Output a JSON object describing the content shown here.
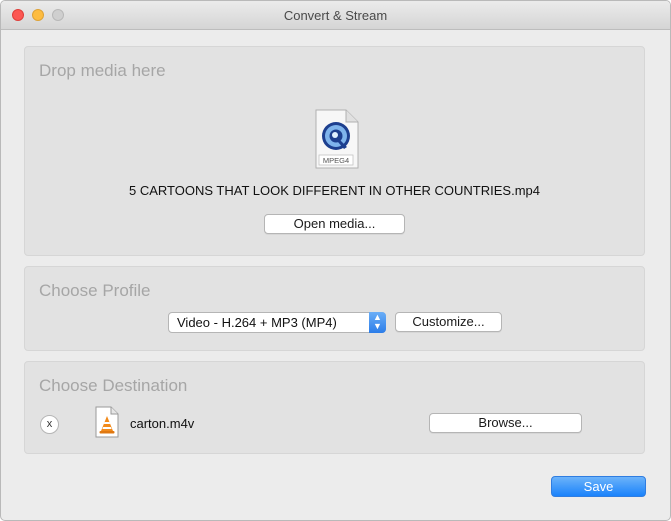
{
  "window": {
    "title": "Convert & Stream"
  },
  "drop_section": {
    "heading": "Drop media here",
    "file_icon": "mpeg4-file-icon",
    "file_icon_label": "MPEG4",
    "filename": "5 CARTOONS THAT LOOK DIFFERENT IN OTHER COUNTRIES.mp4",
    "open_button_label": "Open media..."
  },
  "profile_section": {
    "heading": "Choose Profile",
    "selected_profile": "Video - H.264 + MP3 (MP4)",
    "customize_button_label": "Customize..."
  },
  "destination_section": {
    "heading": "Choose Destination",
    "remove_button_label": "x",
    "file_icon": "vlc-cone-file-icon",
    "filename": "carton.m4v",
    "browse_button_label": "Browse..."
  },
  "footer": {
    "save_button_label": "Save"
  },
  "colors": {
    "accent": "#1a82fb",
    "close": "#fc5753",
    "minimize": "#fdbc40",
    "vlc_orange": "#f28a1a"
  }
}
